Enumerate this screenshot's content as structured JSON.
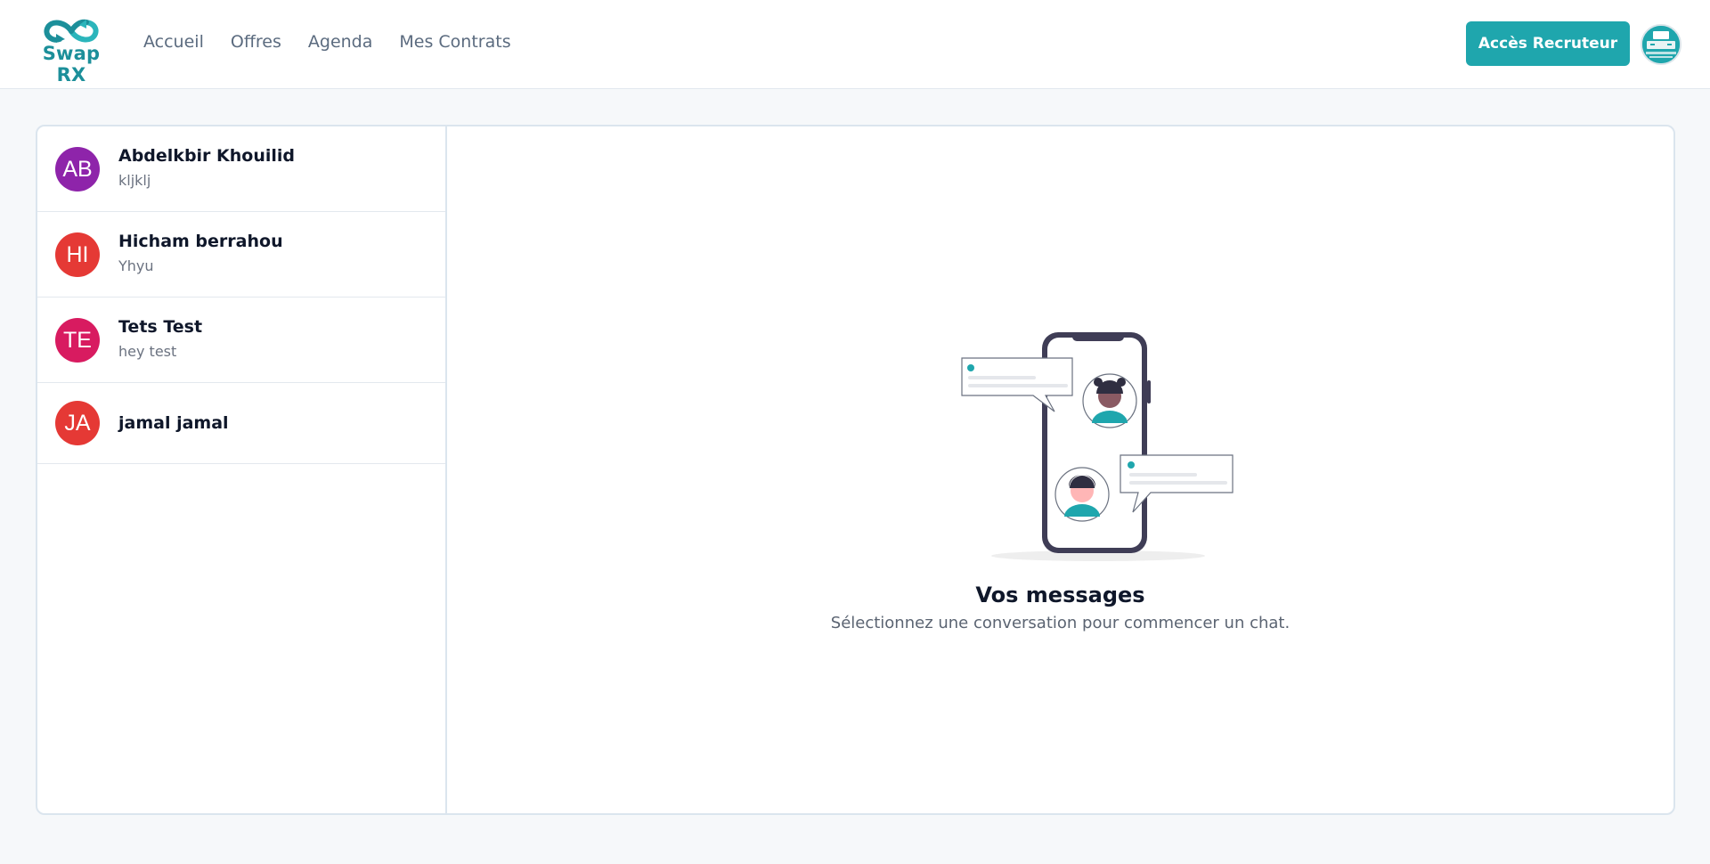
{
  "header": {
    "logo_text": "Swap RX",
    "nav": [
      "Accueil",
      "Offres",
      "Agenda",
      "Mes Contrats"
    ],
    "recruiter_button": "Accès Recruteur",
    "avatar_icon": "user-avatar-icon"
  },
  "conversations": [
    {
      "initials": "AB",
      "name": "Abdelkbir Khouilid",
      "preview": "kljklj",
      "color": "#8e24aa"
    },
    {
      "initials": "HI",
      "name": "Hicham berrahou",
      "preview": "Yhyu",
      "color": "#e53935"
    },
    {
      "initials": "TE",
      "name": "Tets Test",
      "preview": "hey test",
      "color": "#d81b60"
    },
    {
      "initials": "JA",
      "name": "jamal jamal",
      "preview": "",
      "color": "#e53935"
    }
  ],
  "empty_state": {
    "illustration": "phone-chat-illustration",
    "title": "Vos messages",
    "subtitle": "Sélectionnez une conversation pour commencer un chat."
  },
  "colors": {
    "accent": "#1fa6ad",
    "logo": "#1c8f9a",
    "background": "#f6f8fa"
  }
}
